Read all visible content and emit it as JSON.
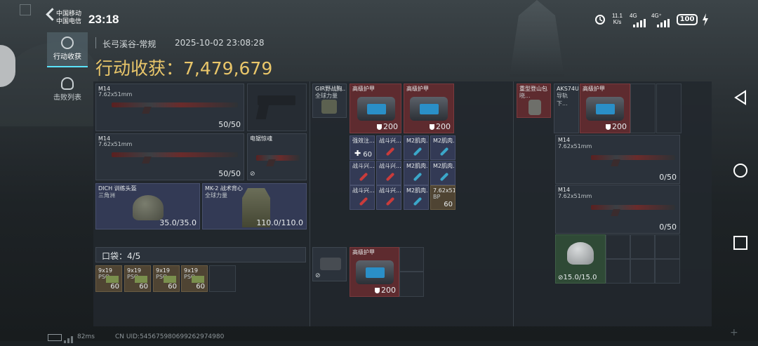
{
  "status_bar": {
    "carrier1": "中国移动",
    "carrier2": "中国电信",
    "time": "23:18",
    "net_speed_value": "11.1",
    "net_speed_unit": "K/s",
    "net1": "4G",
    "net2": "4G⁺",
    "battery": "100"
  },
  "sidebar": {
    "tabs": [
      {
        "label": "行动收获",
        "active": true
      },
      {
        "label": "击败列表",
        "active": false
      }
    ]
  },
  "header": {
    "map": "长弓溪谷-常规",
    "datetime": "2025-10-02 23:08:28",
    "title": "行动收获：7,479,679"
  },
  "loadout": {
    "weapon1": {
      "name": "M14",
      "caliber": "7.62x51mm",
      "ammo": "50/50"
    },
    "pistol": {
      "name": ""
    },
    "weapon2": {
      "name": "M14",
      "caliber": "7.62x51mm",
      "ammo": "50/50"
    },
    "melee": {
      "name": "电锯惊魂"
    },
    "helmet": {
      "name": "DICH 训练头盔",
      "sub": "三角洲",
      "durability": "35.0/35.0"
    },
    "armor": {
      "name": "MK-2 战术背心",
      "sub": "全球力量",
      "durability": "110.0/110.0"
    },
    "pocket_label": "口袋：4/5",
    "pocket_items": [
      {
        "name": "9x19",
        "sub": "PSO",
        "count": "60"
      },
      {
        "name": "9x19",
        "sub": "PSO",
        "count": "60"
      },
      {
        "name": "9x19",
        "sub": "PSO",
        "count": "60"
      },
      {
        "name": "9x19",
        "sub": "PSO",
        "count": "60"
      }
    ]
  },
  "chest_rig": {
    "rig_name": "GIR野战胸...",
    "rig_sub": "全球力量",
    "armor1": {
      "name": "高级护甲",
      "value": "200"
    },
    "armor2": {
      "name": "高级护甲",
      "value": "200"
    },
    "grid": [
      {
        "name": "强效注...",
        "count": "60"
      },
      {
        "name": "战斗兴..."
      },
      {
        "name": "M2肌肉..."
      },
      {
        "name": "M2肌肉..."
      },
      {
        "name": "战斗兴..."
      },
      {
        "name": "战斗兴..."
      },
      {
        "name": "M2肌肉..."
      },
      {
        "name": "M2肌肉..."
      },
      {
        "name": "战斗兴..."
      },
      {
        "name": "战斗兴..."
      },
      {
        "name": "M2肌肉..."
      },
      {
        "name": "7.62x51...",
        "sub": "BP",
        "count": "60"
      }
    ],
    "pouch_armor": {
      "name": "高级护甲",
      "value": "200"
    }
  },
  "backpack": {
    "bag_name": "重型登山包",
    "bag_sub": "晓...",
    "ak_name": "AKS74U",
    "ak_sub": "导轨下...",
    "armor": {
      "name": "高级护甲",
      "value": "200"
    },
    "weapon1": {
      "name": "M14",
      "caliber": "7.62x51mm",
      "ammo": "0/50"
    },
    "weapon2": {
      "name": "M14",
      "caliber": "7.62x51mm",
      "ammo": "0/50"
    },
    "helmet_durability": "15.0/15.0"
  },
  "footer": {
    "ping": "82ms",
    "uid": "CN UID:545675980699262974980"
  },
  "colors": {
    "title_gold": "#e9c66a",
    "accent_cyan": "#5be4ff"
  }
}
